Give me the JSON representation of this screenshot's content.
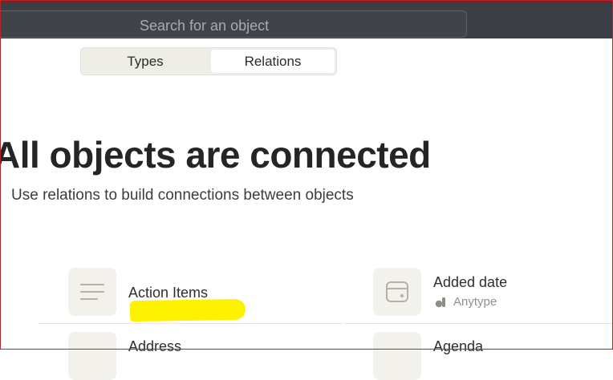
{
  "search": {
    "placeholder": "Search for an object"
  },
  "tabs": [
    {
      "label": "Types"
    },
    {
      "label": "Relations"
    }
  ],
  "empty_state": {
    "title": "All objects are connected",
    "subtitle": "Use relations to build connections between objects"
  },
  "relations": [
    {
      "name": "Action Items",
      "icon": "text-lines-icon"
    },
    {
      "name": "Added date",
      "source": "Anytype",
      "icon": "calendar-icon"
    },
    {
      "name": "Address",
      "icon": "text-lines-icon"
    },
    {
      "name": "Agenda",
      "icon": "text-lines-icon"
    }
  ],
  "colors": {
    "highlight": "#fff200",
    "topbar": "#3b3f45"
  }
}
